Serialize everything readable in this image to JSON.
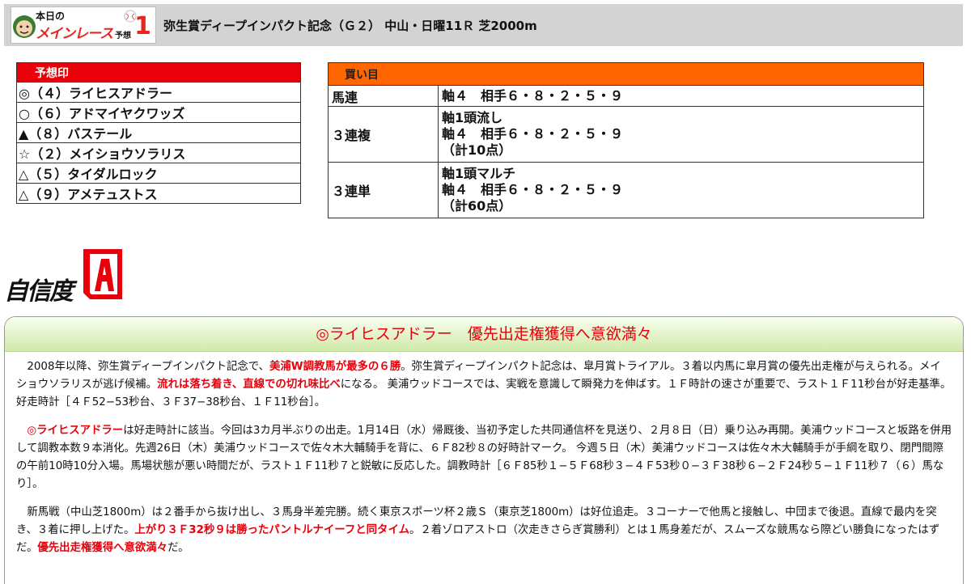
{
  "header": {
    "logo_line1": "本日の",
    "logo_line2": "メインレース",
    "logo_line3": "予想",
    "logo_number": "1",
    "title": "弥生賞ディープインパクト記念（Ｇ２） 中山・日曜11Ｒ 芝2000m"
  },
  "predictions": {
    "heading": "予想印",
    "items": [
      {
        "text": "◎（４）ライヒスアドラー"
      },
      {
        "text": "○（６）アドマイヤクワッズ"
      },
      {
        "text": "▲（８）バステール"
      },
      {
        "text": "☆（２）メイショウソラリス"
      },
      {
        "text": "△（５）タイダルロック"
      },
      {
        "text": "△（９）アメテュストス"
      }
    ]
  },
  "bets": {
    "heading": "買い目",
    "rows": [
      {
        "type": "馬連",
        "line1": "軸４　相手６・８・２・５・９",
        "line2": "",
        "line3": ""
      },
      {
        "type": "３連複",
        "line1": "軸1頭流し",
        "line2": "軸４　相手６・８・２・５・９",
        "line3": "（計10点）"
      },
      {
        "type": "３連単",
        "line1": "軸1頭マルチ",
        "line2": "軸４　相手６・８・２・５・９",
        "line3": "（計60点）"
      }
    ]
  },
  "confidence": {
    "label": "自信度",
    "grade": "A",
    "colors": {
      "accent": "#e8000b"
    }
  },
  "article": {
    "headline": "◎ライヒスアドラー　優先出走権獲得へ意欲満々",
    "p1": {
      "a": "2008年以降、弥生賞ディープインパクト記念で、",
      "b": "美浦W調教馬が最多の６勝",
      "c": "。弥生賞ディープインパクト記念は、皐月賞トライアル。３着以内馬に皐月賞の優先出走権が与えられる。メイショウソラリスが逃げ候補。",
      "d": "流れは落ち着き、直線での切れ味比べ",
      "e": "になる。 美浦ウッドコースでは、実戦を意識して瞬発力を伸ばす。１Ｆ時計の速さが重要で、ラスト１Ｆ11秒台が好走基準。好走時計［４Ｆ52−53秒台、３Ｆ37−38秒台、１Ｆ11秒台］。"
    },
    "p2": {
      "a": "◎ライヒスアドラー",
      "b": "は好走時計に該当。今回は3カ月半ぶりの出走。1月14日（水）帰厩後、当初予定した共同通信杯を見送り、２月８日（日）乗り込み再開。美浦ウッドコースと坂路を併用して調教本数９本消化。先週26日（木）美浦ウッドコースで佐々木大輔騎手を背に、６Ｆ82秒８の好時計マーク。 今週５日（木）美浦ウッドコースは佐々木大輔騎手が手綱を取り、閉門間際の午前10時10分入場。馬場状態が悪い時間だが、ラスト１Ｆ11秒７と鋭敏に反応した。調教時計［６Ｆ85秒１−５Ｆ68秒３−４Ｆ53秒０−３Ｆ38秒６−２Ｆ24秒５−１Ｆ11秒７（６）馬なり］。"
    },
    "p3": {
      "a": "新馬戦（中山芝1800m）は２番手から抜け出し、３馬身半差完勝。続く東京スポーツ杯２歳Ｓ（東京芝1800m）は好位追走。３コーナーで他馬と接触し、中団まで後退。直線で最内を突き、３着に押し上げた。",
      "b": "上がり３Ｆ32秒９は勝ったパントルナイーフと同タイム",
      "c": "。２着ゾロアストロ（次走きさらぎ賞勝利）とは１馬身差だが、スムーズな競馬なら際どい勝負になったはずだ。",
      "d": "優先出走権獲得へ意欲満々",
      "e": "だ。"
    }
  }
}
